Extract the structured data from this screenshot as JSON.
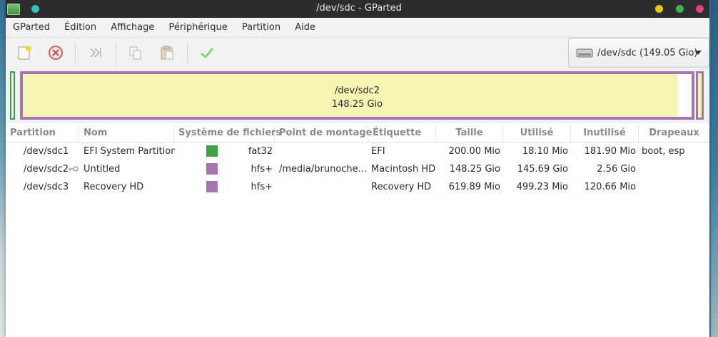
{
  "window": {
    "title": "/dev/sdc - GParted"
  },
  "colors": {
    "titlebar": "#2d2d2d",
    "dot_left": "#33c0c0",
    "dot_yellow": "#e8c61c",
    "dot_green": "#39b54a",
    "dot_pink": "#e2418a",
    "fat32": "#3fa24a",
    "hfs": "#a574b3",
    "used_fill": "#f7f3b3"
  },
  "menu": [
    "GParted",
    "Édition",
    "Affichage",
    "Périphérique",
    "Partition",
    "Aide"
  ],
  "toolbar": {
    "icons": [
      "new-partition-icon",
      "delete-partition-icon",
      "resize-move-icon",
      "copy-icon",
      "paste-icon",
      "apply-icon"
    ],
    "device_label": "/dev/sdc (149.05 Gio)"
  },
  "diskmap": {
    "selected_name": "/dev/sdc2",
    "selected_size": "148.25 Gio"
  },
  "columns": [
    "Partition",
    "Nom",
    "Système de fichiers",
    "Point de montage",
    "Étiquette",
    "Taille",
    "Utilisé",
    "Inutilisé",
    "Drapeaux"
  ],
  "rows": [
    {
      "partition": "/dev/sdc1",
      "name": "EFI System Partition",
      "fs": "fat32",
      "fs_color": "#3fa24a",
      "mount": "",
      "label": "EFI",
      "size": "200.00 Mio",
      "used": "18.10 Mio",
      "unused": "181.90 Mio",
      "flags": "boot, esp",
      "mounted": false
    },
    {
      "partition": "/dev/sdc2",
      "name": "Untitled",
      "fs": "hfs+",
      "fs_color": "#a574b3",
      "mount": "/media/brunoche...",
      "label": "Macintosh HD",
      "size": "148.25 Gio",
      "used": "145.69 Gio",
      "unused": "2.56 Gio",
      "flags": "",
      "mounted": true
    },
    {
      "partition": "/dev/sdc3",
      "name": "Recovery HD",
      "fs": "hfs+",
      "fs_color": "#a574b3",
      "mount": "",
      "label": "Recovery HD",
      "size": "619.89 Mio",
      "used": "499.23 Mio",
      "unused": "120.66 Mio",
      "flags": "",
      "mounted": false
    }
  ]
}
